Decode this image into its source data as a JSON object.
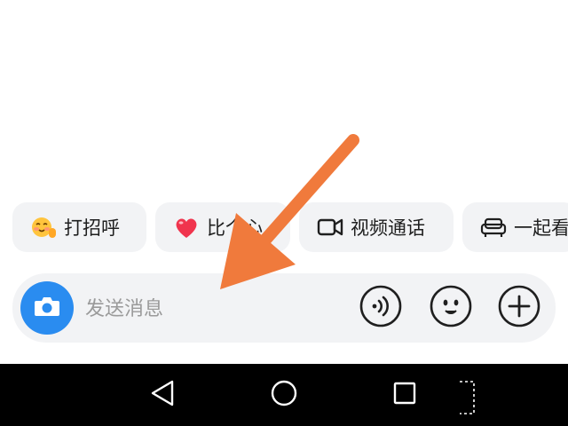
{
  "chips": [
    {
      "label": "打招呼",
      "icon": "smiling-face-waving-icon"
    },
    {
      "label": "比个心",
      "icon": "heart-icon"
    },
    {
      "label": "视频通话",
      "icon": "video-camera-icon"
    },
    {
      "label": "一起看",
      "icon": "sofa-icon"
    }
  ],
  "input_bar": {
    "placeholder": "发送消息",
    "value": "",
    "camera_icon": "camera-icon",
    "voice_icon": "voice-wave-icon",
    "emoji_icon": "emoji-face-icon",
    "plus_icon": "plus-icon"
  },
  "annotation": {
    "shape": "arrow",
    "color": "#f07a3c"
  },
  "navbar": {
    "back_icon": "back-triangle-icon",
    "home_icon": "home-circle-icon",
    "recent_icon": "recent-square-icon"
  },
  "colors": {
    "camera_button": "#2a8cf0",
    "chip_background": "#f2f3f5",
    "navbar_background": "#000000"
  }
}
